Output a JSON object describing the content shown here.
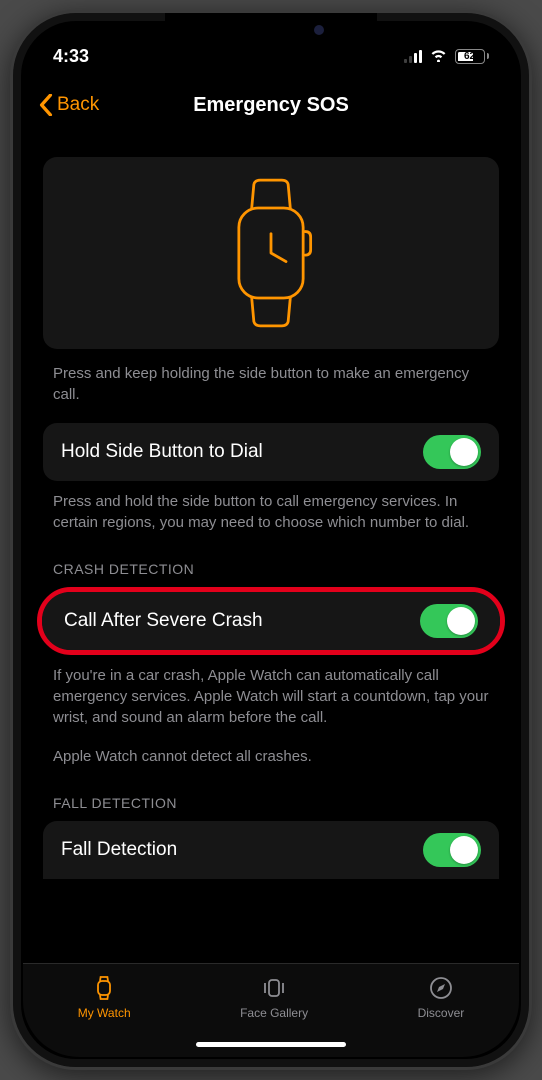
{
  "status": {
    "time": "4:33",
    "battery": "62"
  },
  "nav": {
    "back": "Back",
    "title": "Emergency SOS"
  },
  "hero_desc": "Press and keep holding the side button to make an emergency call.",
  "hold": {
    "label": "Hold Side Button to Dial",
    "desc": "Press and hold the side button to call emergency services. In certain regions, you may need to choose which number to dial."
  },
  "crash": {
    "header": "CRASH DETECTION",
    "label": "Call After Severe Crash",
    "desc": "If you're in a car crash, Apple Watch can automatically call emergency services. Apple Watch will start a countdown, tap your wrist, and sound an alarm before the call.",
    "note": "Apple Watch cannot detect all crashes."
  },
  "fall": {
    "header": "FALL DETECTION",
    "label": "Fall Detection"
  },
  "tabs": {
    "watch": "My Watch",
    "gallery": "Face Gallery",
    "discover": "Discover"
  }
}
